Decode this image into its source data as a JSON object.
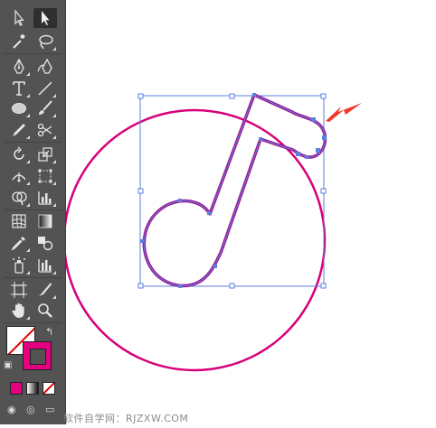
{
  "app": "Adobe Illustrator",
  "toolbar": {
    "tools": [
      {
        "name": "selection-tool",
        "active": false
      },
      {
        "name": "direct-selection-tool",
        "active": true
      },
      {
        "name": "magic-wand-tool",
        "active": false
      },
      {
        "name": "lasso-tool",
        "active": false
      },
      {
        "name": "pen-tool",
        "active": false
      },
      {
        "name": "curvature-tool",
        "active": false
      },
      {
        "name": "type-tool",
        "active": false
      },
      {
        "name": "line-segment-tool",
        "active": false
      },
      {
        "name": "ellipse-tool",
        "active": false
      },
      {
        "name": "paintbrush-tool",
        "active": false
      },
      {
        "name": "pencil-tool",
        "active": false
      },
      {
        "name": "scissors-tool",
        "active": false
      },
      {
        "name": "rotate-tool",
        "active": false
      },
      {
        "name": "scale-tool",
        "active": false
      },
      {
        "name": "width-tool",
        "active": false
      },
      {
        "name": "free-transform-tool",
        "active": false
      },
      {
        "name": "shape-builder-tool",
        "active": false
      },
      {
        "name": "graph-tool",
        "active": false
      },
      {
        "name": "mesh-tool",
        "active": false
      },
      {
        "name": "gradient-tool",
        "active": false
      },
      {
        "name": "eyedropper-tool",
        "active": false
      },
      {
        "name": "blend-tool",
        "active": false
      },
      {
        "name": "symbol-sprayer-tool",
        "active": false
      },
      {
        "name": "column-graph-tool",
        "active": false
      },
      {
        "name": "artboard-tool",
        "active": false
      },
      {
        "name": "slice-tool",
        "active": false
      },
      {
        "name": "hand-tool",
        "active": false
      },
      {
        "name": "zoom-tool",
        "active": false
      }
    ],
    "fill_color": "none",
    "stroke_color": "#e4007f"
  },
  "canvas": {
    "circle_stroke": "#d6007a",
    "path_stroke": "#a1168f",
    "selection_color": "#5b7fe0",
    "arrow_color": "#f03a2e"
  },
  "watermark": "软件自学网：RJZXW.COM"
}
